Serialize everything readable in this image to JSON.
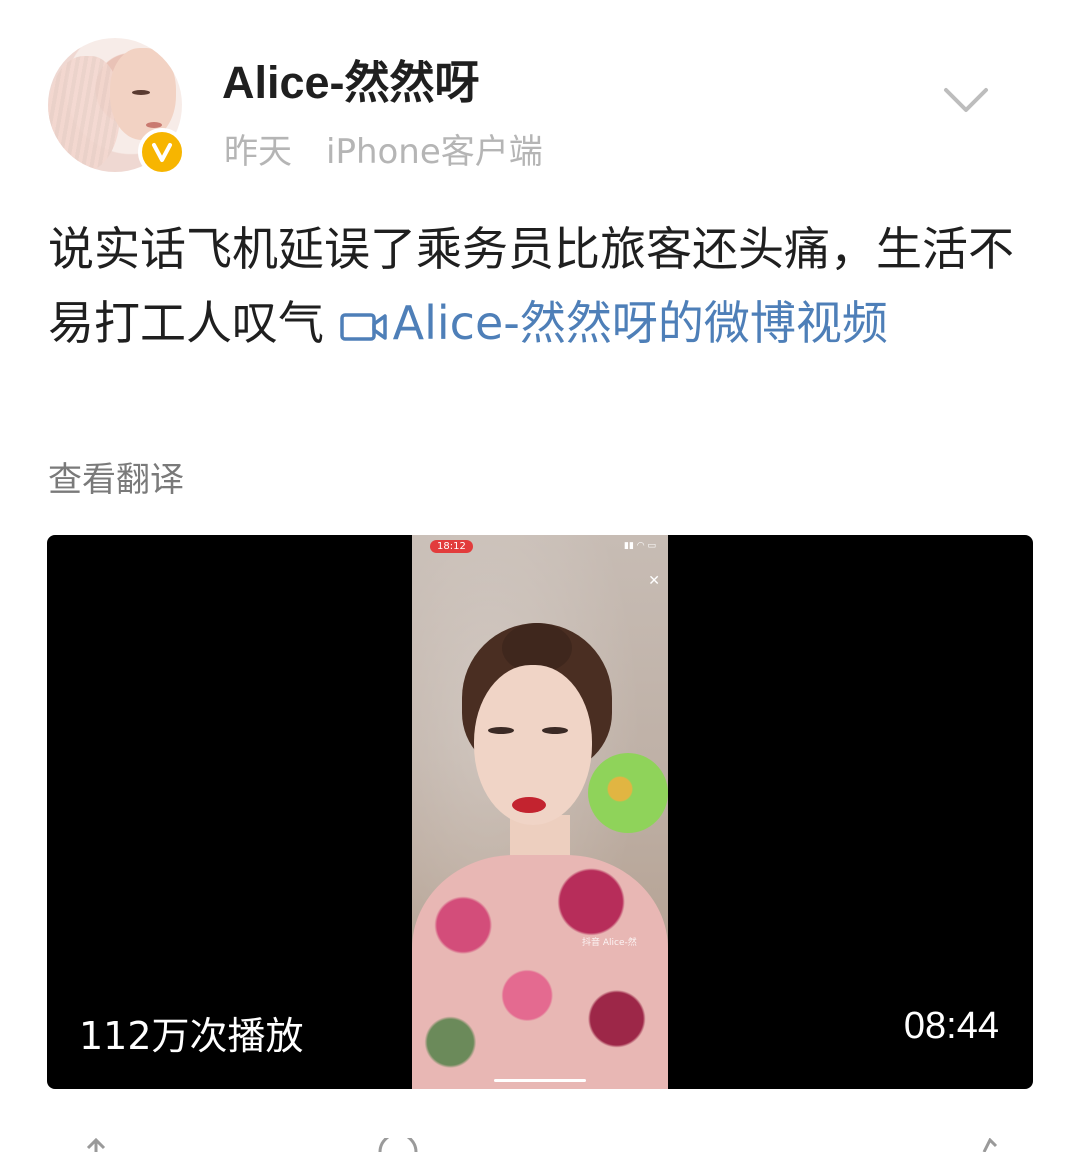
{
  "post": {
    "username": "Alice-然然呀",
    "time": "昨天",
    "source": "iPhone客户端",
    "text": "说实话飞机延误了乘务员比旅客还头痛，生活不易打工人叹气 ",
    "video_link": "Alice-然然呀的微博视频",
    "translate_label": "查看翻译"
  },
  "video": {
    "play_count": "112万次播放",
    "duration": "08:44",
    "inner_status_time": "18:12",
    "inner_watermark": "抖音 Alice-然"
  },
  "colors": {
    "link": "#4e7fb8",
    "verified_badge": "#f7b500",
    "meta_gray": "#b5b5b5"
  },
  "icons": {
    "verified": "verified-v-icon",
    "more": "chevron-down-icon",
    "video_link": "video-camera-icon"
  }
}
